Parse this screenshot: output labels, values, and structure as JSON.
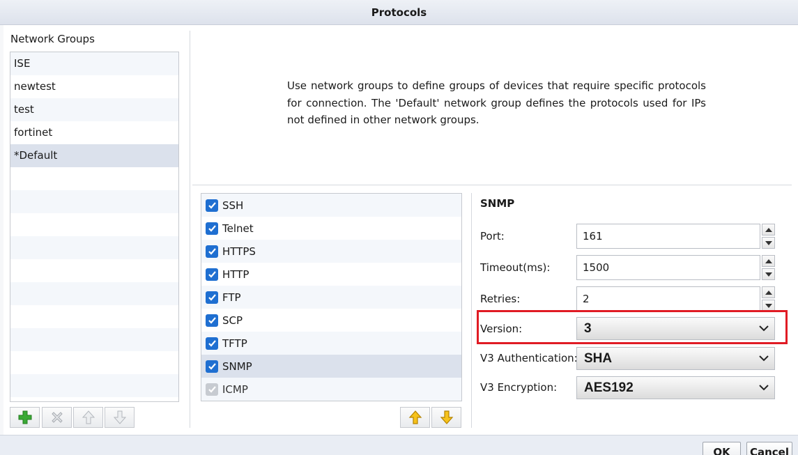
{
  "dialog": {
    "title": "Protocols"
  },
  "network_groups": {
    "title": "Network Groups",
    "items": [
      {
        "label": "ISE"
      },
      {
        "label": "newtest"
      },
      {
        "label": "test"
      },
      {
        "label": "fortinet"
      },
      {
        "label": "*Default",
        "selected": true
      }
    ],
    "toolbar": {
      "add_icon": "plus-icon",
      "delete_icon": "x-icon",
      "move_up_icon": "arrow-up-icon",
      "move_down_icon": "arrow-down-icon"
    }
  },
  "description": "Use network groups to define groups of devices that require specific protocols for connection. The 'Default' network group defines the protocols used for IPs not defined in other network groups.",
  "protocols": {
    "items": [
      {
        "label": "SSH",
        "checked": true,
        "disabled": false
      },
      {
        "label": "Telnet",
        "checked": true,
        "disabled": false
      },
      {
        "label": "HTTPS",
        "checked": true,
        "disabled": false
      },
      {
        "label": "HTTP",
        "checked": true,
        "disabled": false
      },
      {
        "label": "FTP",
        "checked": true,
        "disabled": false
      },
      {
        "label": "SCP",
        "checked": true,
        "disabled": false
      },
      {
        "label": "TFTP",
        "checked": true,
        "disabled": false
      },
      {
        "label": "SNMP",
        "checked": true,
        "disabled": false,
        "selected": true
      },
      {
        "label": "ICMP",
        "checked": true,
        "disabled": true
      }
    ]
  },
  "snmp": {
    "title": "SNMP",
    "port": {
      "label": "Port:",
      "value": "161"
    },
    "timeout": {
      "label": "Timeout(ms):",
      "value": "1500"
    },
    "retries": {
      "label": "Retries:",
      "value": "2"
    },
    "version": {
      "label": "Version:",
      "value": "3"
    },
    "v3_auth": {
      "label": "V3 Authentication:",
      "value": "SHA"
    },
    "v3_enc": {
      "label": "V3 Encryption:",
      "value": "AES192"
    }
  },
  "buttons": {
    "ok": "OK",
    "cancel": "Cancel"
  },
  "colors": {
    "checkbox": "#1f6fd1",
    "highlight": "#e01b24",
    "selected_row": "#dbe1ec",
    "arrow_yellow": "#f2b705",
    "plus_green": "#3aa935"
  }
}
